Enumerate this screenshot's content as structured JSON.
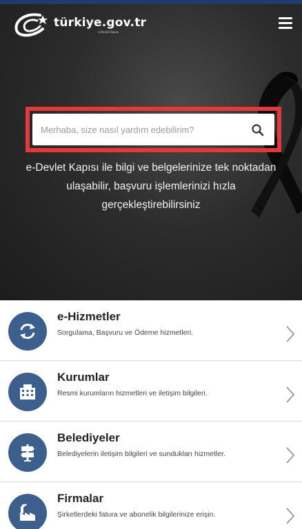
{
  "header": {
    "logo_text": "türkiye.gov.tr",
    "logo_tagline": "e-Devlet Kapısı",
    "menu_icon": "hamburger-menu-icon"
  },
  "search": {
    "placeholder": "Merhaba, size nasıl yardım edebilirim?",
    "icon": "search-icon",
    "highlight_color": "#e23a3a"
  },
  "hero": {
    "tagline_lines": [
      "e-Devlet Kapısı ile bilgi ve belgelerinize tek noktadan",
      "ulaşabilir, başvuru işlemlerinizi hızla",
      "gerçekleştirebilirsiniz"
    ],
    "ribbon_icon": "black-mourning-ribbon-icon"
  },
  "colors": {
    "accent": "#3c5f8e",
    "top_bar": "#1f3a6b"
  },
  "services": [
    {
      "title": "e-Hizmetler",
      "description": "Sorgulama, Başvuru ve Ödeme hizmetleri.",
      "icon": "refresh-arrows-icon"
    },
    {
      "title": "Kurumlar",
      "description": "Resmi kurumların hizmetleri ve iletişim bilgileri.",
      "icon": "building-icon"
    },
    {
      "title": "Belediyeler",
      "description": "Belediyelerin iletişim bilgileri ve sundukları hizmetler.",
      "icon": "signpost-icon"
    },
    {
      "title": "Firmalar",
      "description": "Şirketlerdeki fatura ve abonelik bilgilerinize erişin.",
      "icon": "factory-icon"
    }
  ]
}
